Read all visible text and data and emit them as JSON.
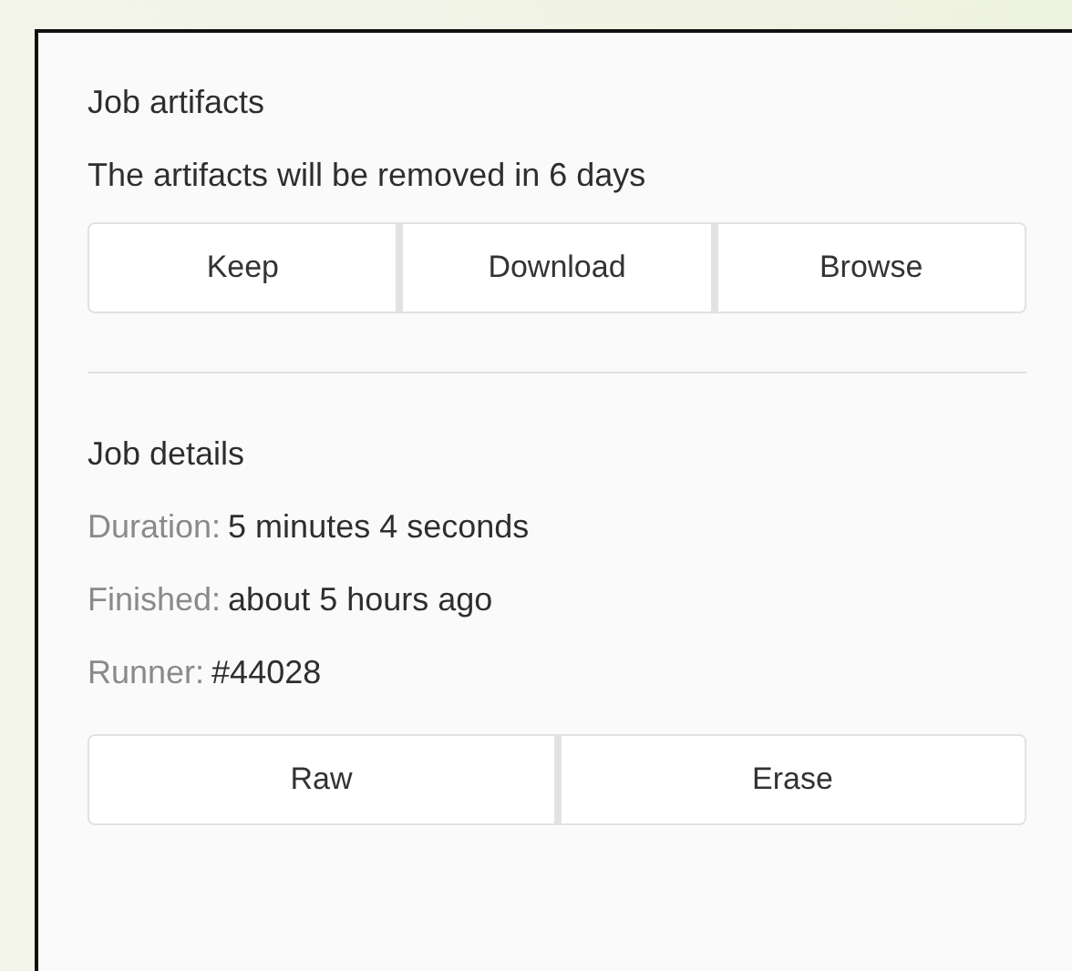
{
  "artifacts": {
    "title": "Job artifacts",
    "notice": "The artifacts will be removed in 6 days",
    "buttons": [
      "Keep",
      "Download",
      "Browse"
    ]
  },
  "details": {
    "title": "Job details",
    "fields": [
      {
        "label": "Duration:",
        "value": "5 minutes 4 seconds"
      },
      {
        "label": "Finished:",
        "value": "about 5 hours ago"
      },
      {
        "label": "Runner:",
        "value": "#44028"
      }
    ],
    "buttons": [
      "Raw",
      "Erase"
    ]
  }
}
